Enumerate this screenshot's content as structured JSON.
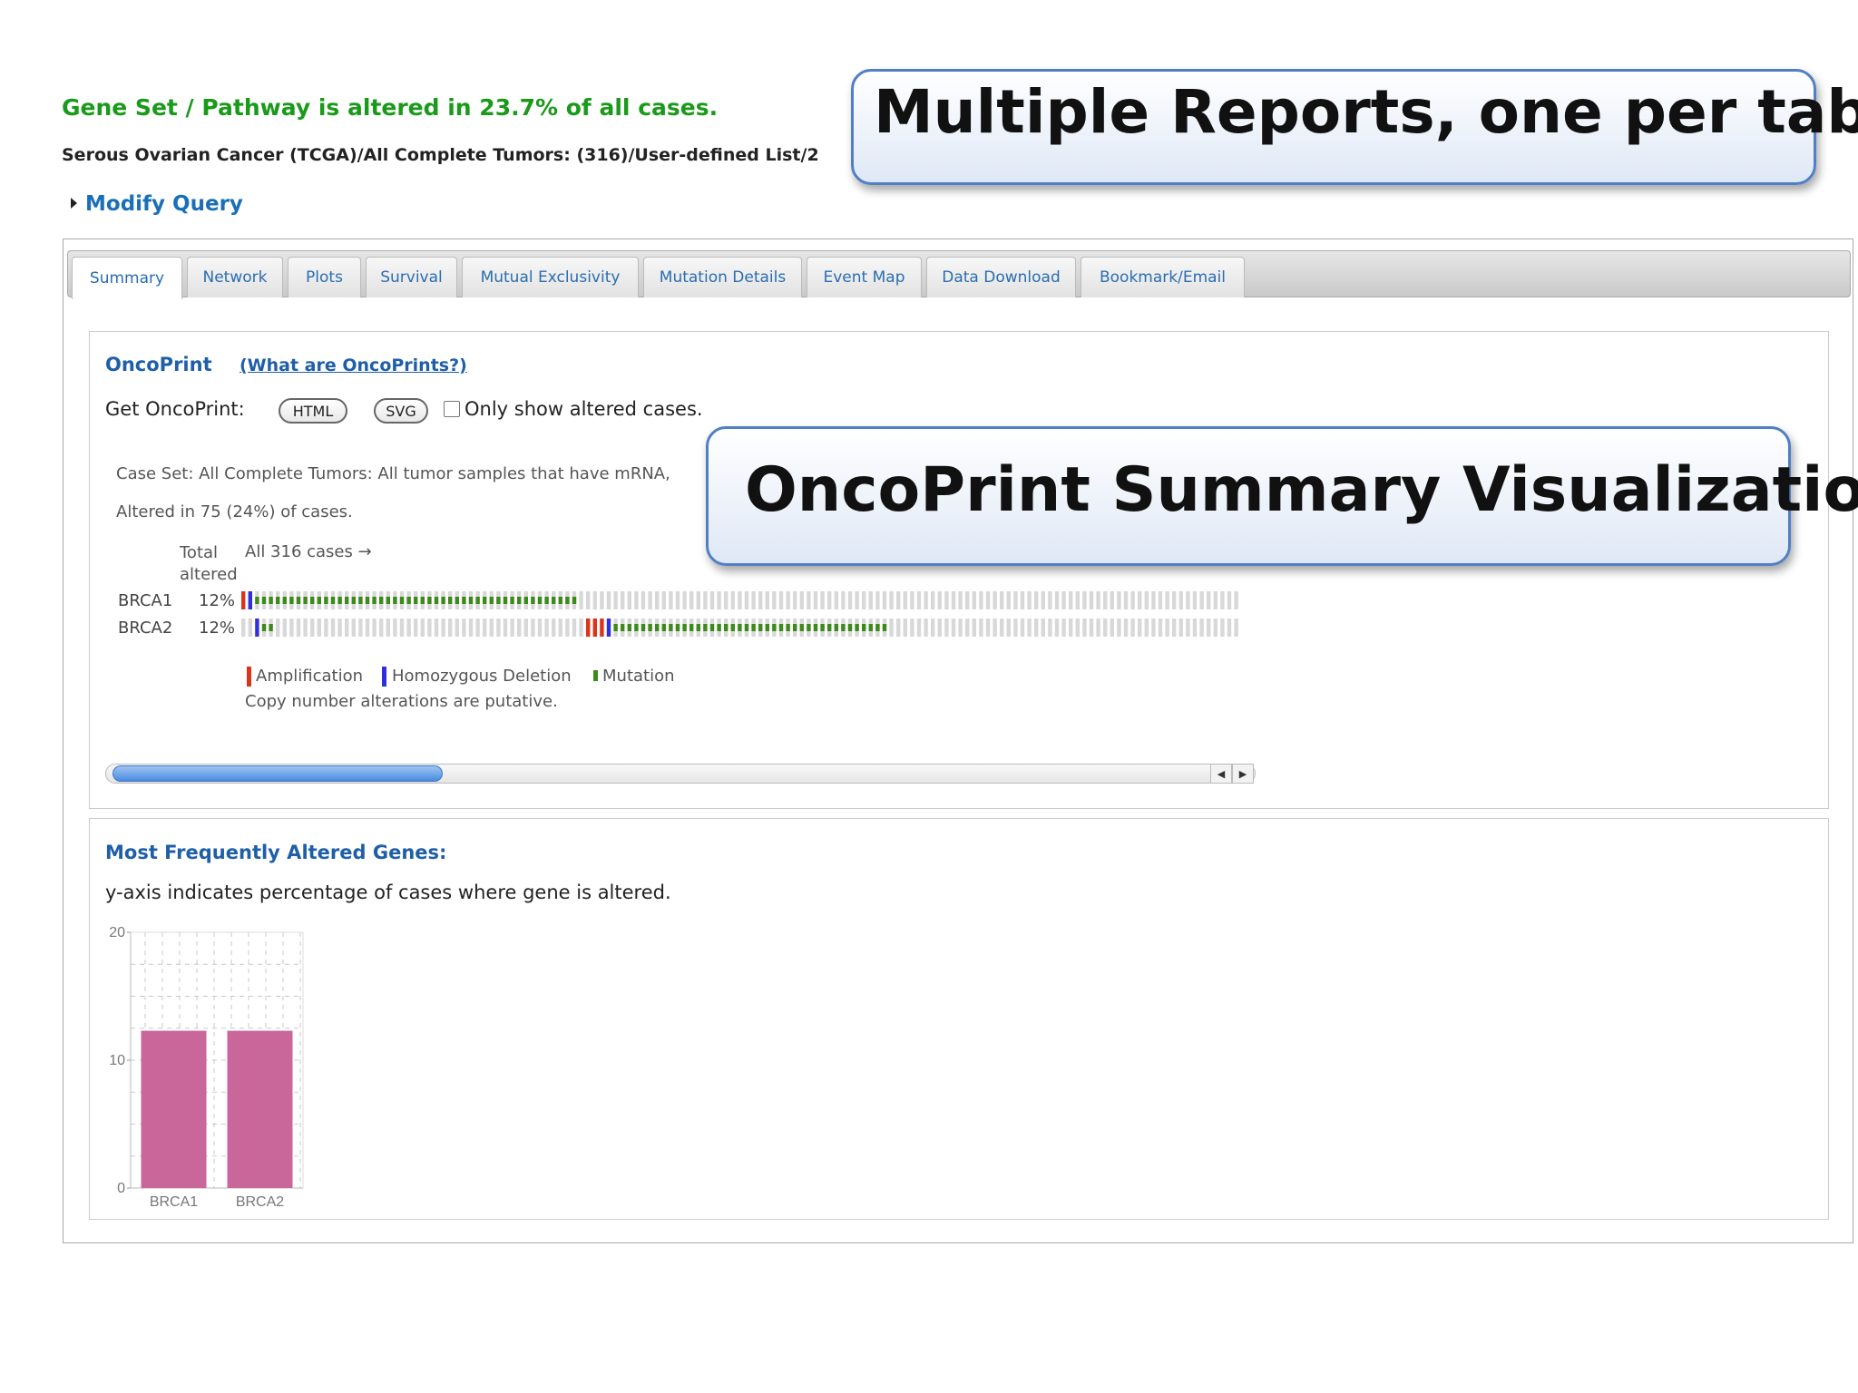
{
  "header": {
    "headline": "Gene Set / Pathway is altered in 23.7% of all cases.",
    "subline": "Serous Ovarian Cancer (TCGA)/All Complete Tumors: (316)/User-defined List/2",
    "modify_query": "Modify Query"
  },
  "callouts": {
    "tabs": "Multiple Reports, one per tab",
    "oncoprint": "OncoPrint Summary Visualization"
  },
  "tabs": [
    {
      "label": "Summary",
      "active": true
    },
    {
      "label": "Network"
    },
    {
      "label": "Plots"
    },
    {
      "label": "Survival"
    },
    {
      "label": "Mutual Exclusivity"
    },
    {
      "label": "Mutation Details"
    },
    {
      "label": "Event Map"
    },
    {
      "label": "Data Download"
    },
    {
      "label": "Bookmark/Email"
    }
  ],
  "oncoprint": {
    "title": "OncoPrint",
    "help_link": "(What are OncoPrints?)",
    "get_label": "Get OncoPrint:",
    "html_button": "HTML",
    "svg_button": "SVG",
    "only_altered_label": "Only show altered cases.",
    "only_altered_checked": false,
    "case_set": "Case Set: All Complete Tumors: All tumor samples that have mRNA,",
    "altered_summary": "Altered in 75 (24%) of cases.",
    "total_altered_label": "Total altered",
    "all_cases_label": "All 316 cases →",
    "genes": [
      {
        "name": "BRCA1",
        "pct": "12%"
      },
      {
        "name": "BRCA2",
        "pct": "12%"
      }
    ],
    "legend": [
      {
        "label": "Amplification",
        "color": "#d9351c"
      },
      {
        "label": "Homozygous Deletion",
        "color": "#2f2fe0"
      },
      {
        "label": "Mutation",
        "color": "#3b8a1a"
      }
    ],
    "legend_note": "Copy number alterations are putative.",
    "scroll_left_arrow": "◀",
    "scroll_right_arrow": "▶",
    "colors": {
      "unaltered": "#d8d8d8"
    }
  },
  "frequency": {
    "title": "Most Frequently Altered Genes:",
    "subtitle": "y-axis indicates percentage of cases where gene is altered."
  },
  "chart_data": {
    "type": "bar",
    "categories": [
      "BRCA1",
      "BRCA2"
    ],
    "values": [
      12.3,
      12.3
    ],
    "ylim": [
      0,
      20
    ],
    "yticks": [
      0,
      10,
      20
    ],
    "grid": true,
    "bar_color": "#c9679a"
  }
}
